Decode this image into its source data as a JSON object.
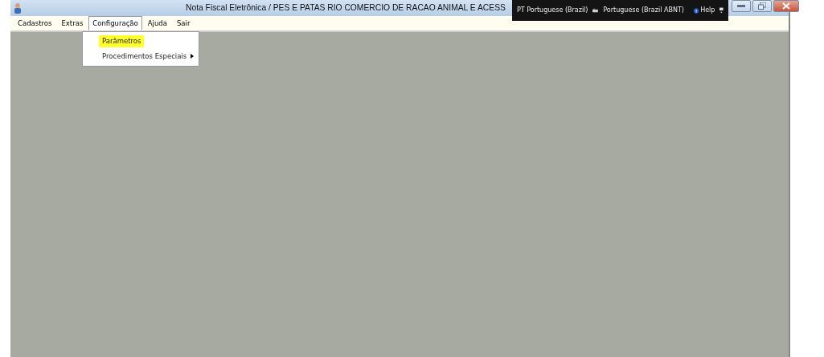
{
  "window": {
    "title": "Nota Fiscal Eletrônica / PES E PATAS RIO COMERCIO DE RACAO ANIMAL E ACESS"
  },
  "language_bar": {
    "language": "PT Portuguese (Brazil)",
    "keyboard": "Portuguese (Brazil ABNT)",
    "help": "Help"
  },
  "menu_bar": [
    {
      "label": "Cadastros",
      "selected": false
    },
    {
      "label": "Extras",
      "selected": false
    },
    {
      "label": "Configuração",
      "selected": true
    },
    {
      "label": "Ajuda",
      "selected": false
    },
    {
      "label": "Sair",
      "selected": false
    }
  ],
  "dropdown": [
    {
      "label": "Parâmetros",
      "selected": true,
      "submenu": false
    },
    {
      "label": "Procedimentos Especiais",
      "selected": false,
      "submenu": true
    }
  ]
}
